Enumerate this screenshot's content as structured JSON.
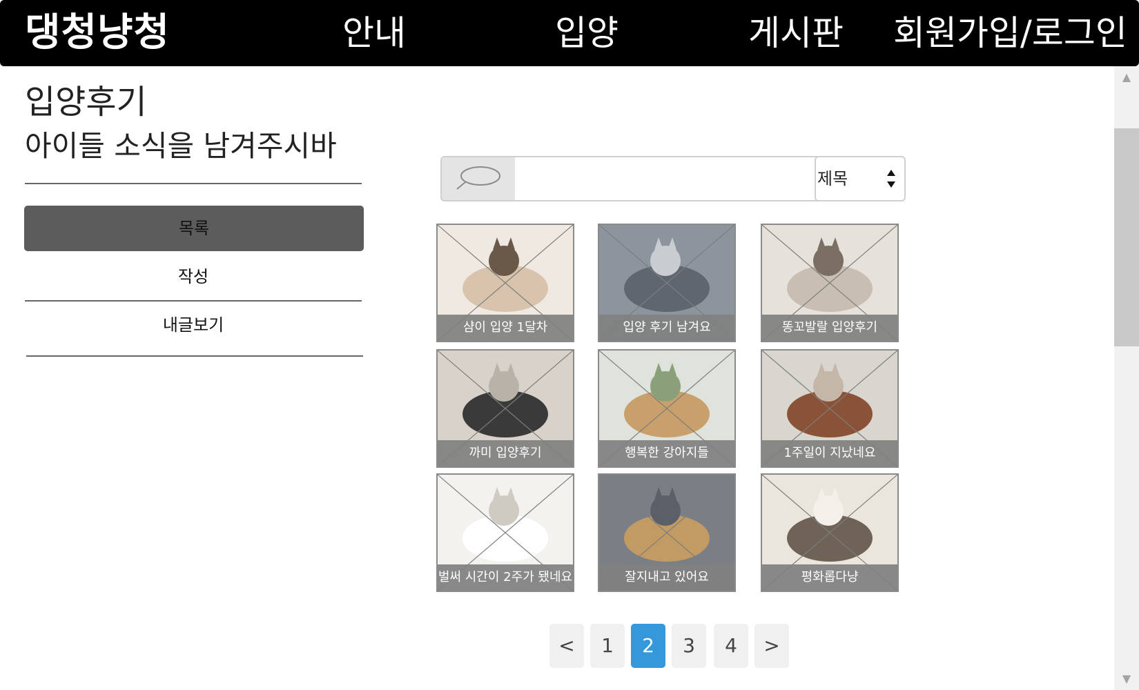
{
  "nav": {
    "brand": "댕청냥청",
    "items": [
      "안내",
      "입양",
      "게시판",
      "회원가입/로그인"
    ]
  },
  "sidebar": {
    "title": "입양후기",
    "subtitle": "아이들 소식을 남겨주시바",
    "menu": [
      "목록",
      "작성",
      "내글보기"
    ],
    "active_index": 0
  },
  "search": {
    "placeholder": "",
    "value": "",
    "select_value": "제목",
    "icon": "search-icon"
  },
  "gallery": {
    "items": [
      {
        "caption": "샴이 입양 1달차",
        "subject": "siamese-cat-photo"
      },
      {
        "caption": "입양 후기 남겨요",
        "subject": "gray-cat-photo"
      },
      {
        "caption": "똥꼬발랄 입양후기",
        "subject": "two-kittens-photo"
      },
      {
        "caption": "까미 입양후기",
        "subject": "black-cat-photo"
      },
      {
        "caption": "행복한 강아지들",
        "subject": "three-dogs-photo"
      },
      {
        "caption": "1주일이 지났네요",
        "subject": "poodle-photo"
      },
      {
        "caption": "벌써 시간이 2주가 됐네요",
        "subject": "white-puppy-photo"
      },
      {
        "caption": "잘지내고 있어요",
        "subject": "sleeping-cat-photo"
      },
      {
        "caption": "평화롭다냥",
        "subject": "tabby-cat-photo"
      }
    ]
  },
  "pagination": {
    "prev": "<",
    "pages": [
      "1",
      "2",
      "3",
      "4"
    ],
    "next": ">",
    "current": "2"
  },
  "colors": {
    "nav_bg": "#000000",
    "active_menu": "#5c5c5c",
    "active_page": "#3498db",
    "caption_bg": "#808080"
  }
}
